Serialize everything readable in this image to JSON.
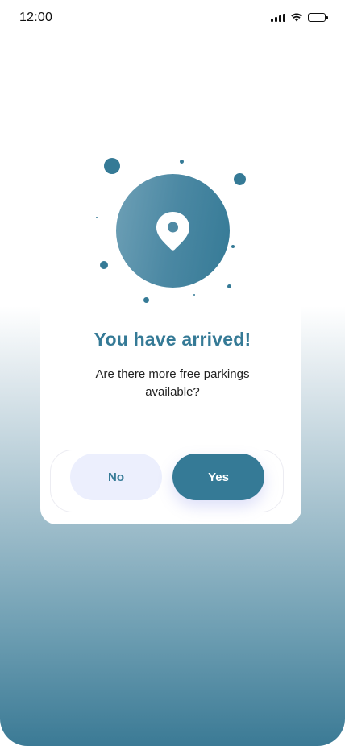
{
  "status_bar": {
    "time": "12:00",
    "icons": [
      "signal-icon",
      "wifi-icon",
      "battery-icon"
    ]
  },
  "dialog": {
    "icon": "location-pin-icon",
    "title": "You have arrived!",
    "message": "Are there more free parkings available?",
    "buttons": {
      "no_label": "No",
      "yes_label": "Yes"
    }
  },
  "colors": {
    "accent": "#357a96",
    "no_button_bg": "#eceffd",
    "text": "#222222"
  }
}
